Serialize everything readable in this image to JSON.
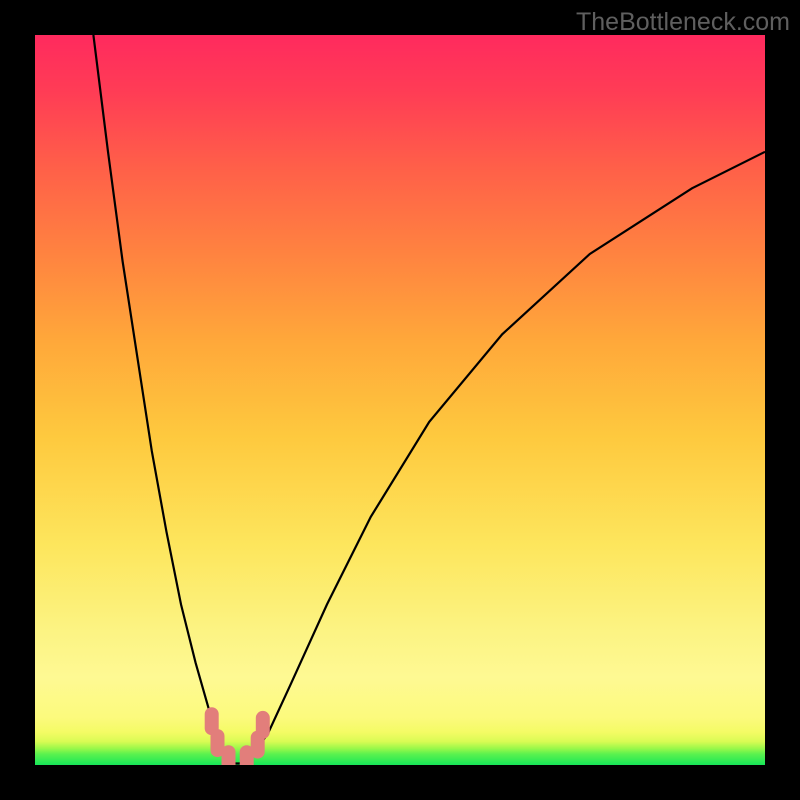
{
  "watermark": {
    "text": "TheBottleneck.com"
  },
  "colors": {
    "frame": "#000000",
    "curve": "#000000",
    "marker": "#e27e7b",
    "gradient_top": "#ff2a5e",
    "gradient_bottom": "#17e658"
  },
  "chart_data": {
    "type": "line",
    "title": "",
    "xlabel": "",
    "ylabel": "",
    "xlim": [
      0,
      100
    ],
    "ylim": [
      0,
      100
    ],
    "grid": false,
    "legend": false,
    "note": "No numeric axis ticks are shown; x/y are normalized 0–100. Values estimated from pixel positioning.",
    "series": [
      {
        "name": "bottleneck-curve",
        "x": [
          8,
          10,
          12,
          14,
          16,
          18,
          20,
          22,
          24,
          25,
          25.5,
          26,
          27,
          28,
          29,
          30,
          32,
          35,
          40,
          46,
          54,
          64,
          76,
          90,
          100
        ],
        "y": [
          100,
          84,
          69,
          56,
          43,
          32,
          22,
          14,
          7,
          3.5,
          1.7,
          0.7,
          0.2,
          0.2,
          0.6,
          1.5,
          4.5,
          11,
          22,
          34,
          47,
          59,
          70,
          79,
          84
        ]
      }
    ],
    "annotations": [
      {
        "name": "min-region-markers",
        "shape": "rounded-rect",
        "color": "#e27e7b",
        "points": [
          {
            "x": 24.2,
            "y": 6.0
          },
          {
            "x": 25.0,
            "y": 3.0
          },
          {
            "x": 26.5,
            "y": 0.8
          },
          {
            "x": 29.0,
            "y": 0.8
          },
          {
            "x": 30.5,
            "y": 2.8
          },
          {
            "x": 31.2,
            "y": 5.5
          }
        ]
      }
    ]
  }
}
